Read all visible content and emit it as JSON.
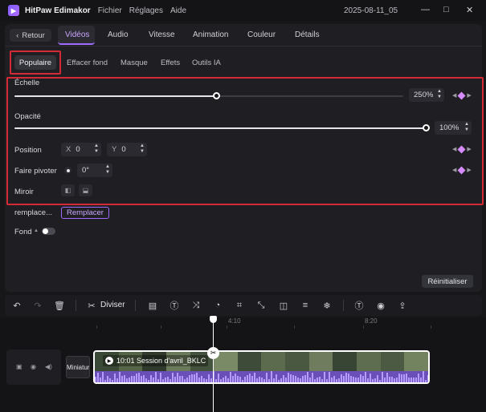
{
  "app": {
    "name": "HitPaw Edimakor",
    "menu": [
      "Fichier",
      "Réglages",
      "Aide"
    ],
    "project_title": "2025-08-11_05",
    "window_controls": {
      "minimize": "—",
      "maximize": "□",
      "close": "✕"
    }
  },
  "tabs": {
    "back_label": "Retour",
    "items": [
      "Vidéos",
      "Audio",
      "Vitesse",
      "Animation",
      "Couleur",
      "Détails"
    ],
    "active": "Vidéos"
  },
  "subtabs": {
    "items": [
      "Populaire",
      "Effacer fond",
      "Masque",
      "Effets",
      "Outils IA"
    ],
    "active": "Populaire"
  },
  "properties": {
    "scale": {
      "label": "Échelle",
      "value": "250%",
      "fill": 0.52
    },
    "opacity": {
      "label": "Opacité",
      "value": "100%",
      "fill": 1.0
    },
    "position": {
      "label": "Position",
      "x_label": "X",
      "x_value": "0",
      "y_label": "Y",
      "y_value": "0"
    },
    "rotate": {
      "label": "Faire pivoter",
      "value": "0°"
    },
    "mirror": {
      "label": "Miroir"
    },
    "replace": {
      "label": "remplace...",
      "button": "Remplacer"
    },
    "background": {
      "label": "Fond"
    },
    "reset_button": "Réinitialiser"
  },
  "toolbar": {
    "divide_label": "Diviser"
  },
  "timeline": {
    "ruler": [
      "4:10",
      "8:20"
    ],
    "thumbnail_label": "Miniatur",
    "clip_title": "10:01 Session d'avril_BKLC"
  },
  "colors": {
    "accent": "#a06bff",
    "highlight_box": "#d42a35",
    "keyframe": "#d68cff",
    "waveform": "#6a4fb8"
  }
}
